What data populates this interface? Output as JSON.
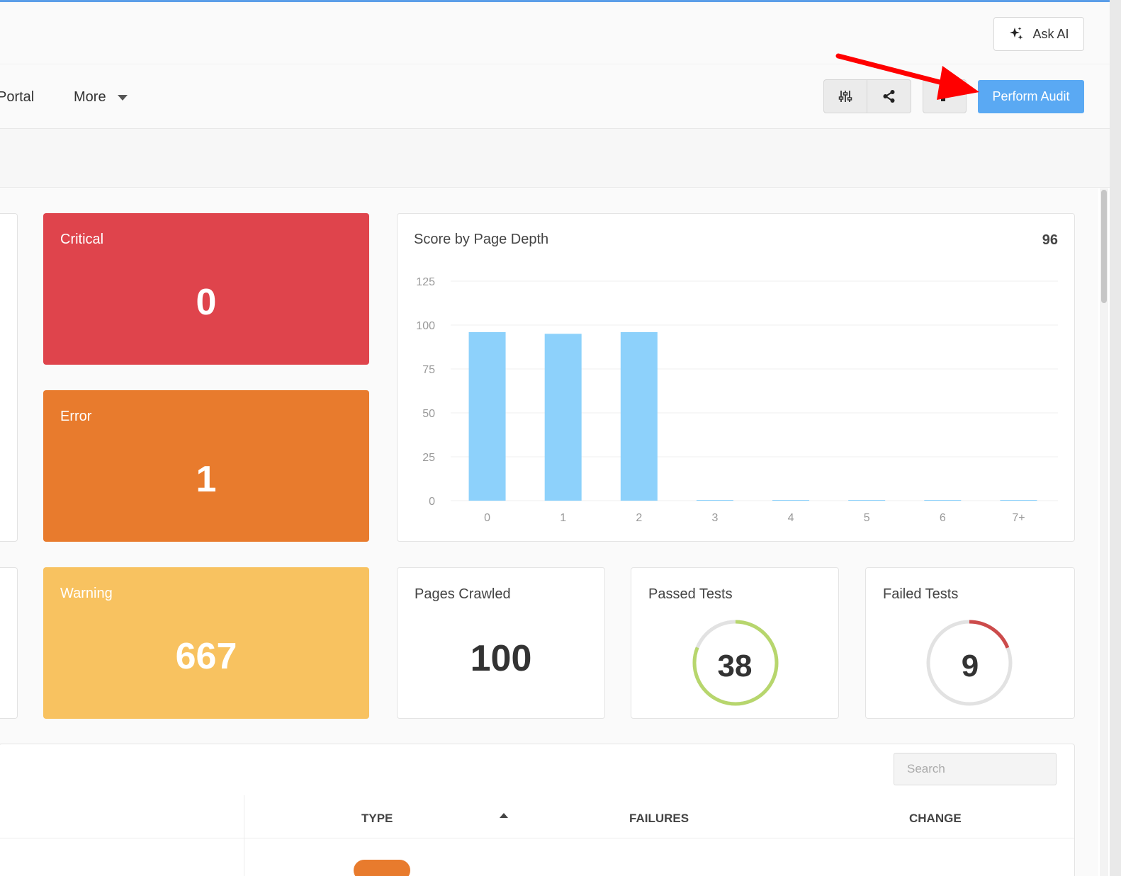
{
  "topbar": {
    "ask_ai_label": "Ask AI"
  },
  "nav": {
    "portal_label": "Portal",
    "more_label": "More",
    "perform_audit_label": "Perform Audit"
  },
  "cards": {
    "critical": {
      "label": "Critical",
      "value": "0",
      "color": "#df444c"
    },
    "error": {
      "label": "Error",
      "value": "1",
      "color": "#e87b2d"
    },
    "warning": {
      "label": "Warning",
      "value": "667",
      "color": "#f8c260"
    },
    "pages_crawled": {
      "label": "Pages Crawled",
      "value": "100"
    },
    "passed_tests": {
      "label": "Passed Tests",
      "value": "38",
      "fraction": 0.81,
      "color": "#b7d66d"
    },
    "failed_tests": {
      "label": "Failed Tests",
      "value": "9",
      "fraction": 0.19,
      "color": "#cc4b4b"
    }
  },
  "chart_data": {
    "type": "bar",
    "title": "Score by Page Depth",
    "score": "96",
    "categories": [
      "0",
      "1",
      "2",
      "3",
      "4",
      "5",
      "6",
      "7+"
    ],
    "values": [
      96,
      95,
      96,
      0,
      0,
      0,
      0,
      0
    ],
    "yticks": [
      "0",
      "25",
      "50",
      "75",
      "100",
      "125"
    ],
    "ylim": [
      0,
      125
    ],
    "bar_color": "#8dd1fb",
    "grid": true
  },
  "table": {
    "search_placeholder": "Search",
    "columns": [
      "TYPE",
      "FAILURES",
      "CHANGE"
    ]
  },
  "annotation": {
    "arrow_color": "#ff0000"
  }
}
